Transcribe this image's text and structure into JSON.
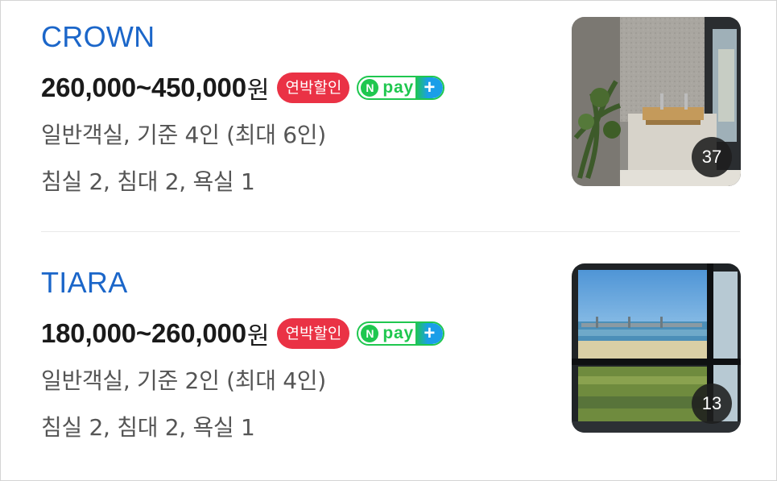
{
  "rooms": [
    {
      "name": "CROWN",
      "price": "260,000~450,000",
      "currency": "원",
      "discount_badge": "연박할인",
      "npay": {
        "n": "N",
        "text": "pay",
        "plus": "+"
      },
      "info_line1": "일반객실, 기준 4인 (최대 6인)",
      "info_line2": "침실 2, 침대 2, 욕실 1",
      "photo_count": "37",
      "photo_icon": "bathroom-photo"
    },
    {
      "name": "TIARA",
      "price": "180,000~260,000",
      "currency": "원",
      "discount_badge": "연박할인",
      "npay": {
        "n": "N",
        "text": "pay",
        "plus": "+"
      },
      "info_line1": "일반객실, 기준 2인 (최대 4인)",
      "info_line2": "침실 2, 침대 2, 욕실 1",
      "photo_count": "13",
      "photo_icon": "ocean-view-photo"
    }
  ],
  "colors": {
    "room_name": "#1b66c9",
    "discount_badge": "#ea3245",
    "npay_green": "#1fc74f",
    "npay_blue": "#1a9ee8"
  }
}
